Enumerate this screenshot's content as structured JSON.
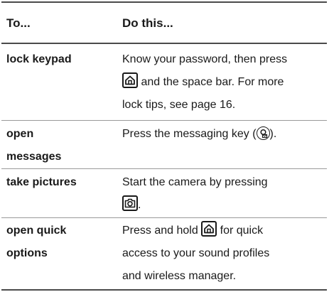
{
  "header": {
    "col1": "To...",
    "col2": "Do this..."
  },
  "rows": [
    {
      "term_lines": [
        "lock keypad"
      ],
      "desc": [
        [
          "Know your password, then press"
        ],
        [
          "",
          "home-key-icon",
          " and the space bar. For more"
        ],
        [
          "lock tips, see page 16."
        ]
      ]
    },
    {
      "term_lines": [
        "open",
        "messages"
      ],
      "desc": [
        [
          "Press the messaging key (",
          "messaging-key-icon",
          ")."
        ]
      ]
    },
    {
      "term_lines": [
        "take pictures"
      ],
      "desc": [
        [
          "Start the camera by pressing"
        ],
        [
          "",
          "camera-key-icon",
          "."
        ]
      ]
    },
    {
      "term_lines": [
        "open quick",
        "options"
      ],
      "desc": [
        [
          "Press and hold ",
          "home-key-icon",
          " for quick"
        ],
        [
          "access to your sound profiles"
        ],
        [
          "and wireless manager."
        ]
      ]
    }
  ]
}
